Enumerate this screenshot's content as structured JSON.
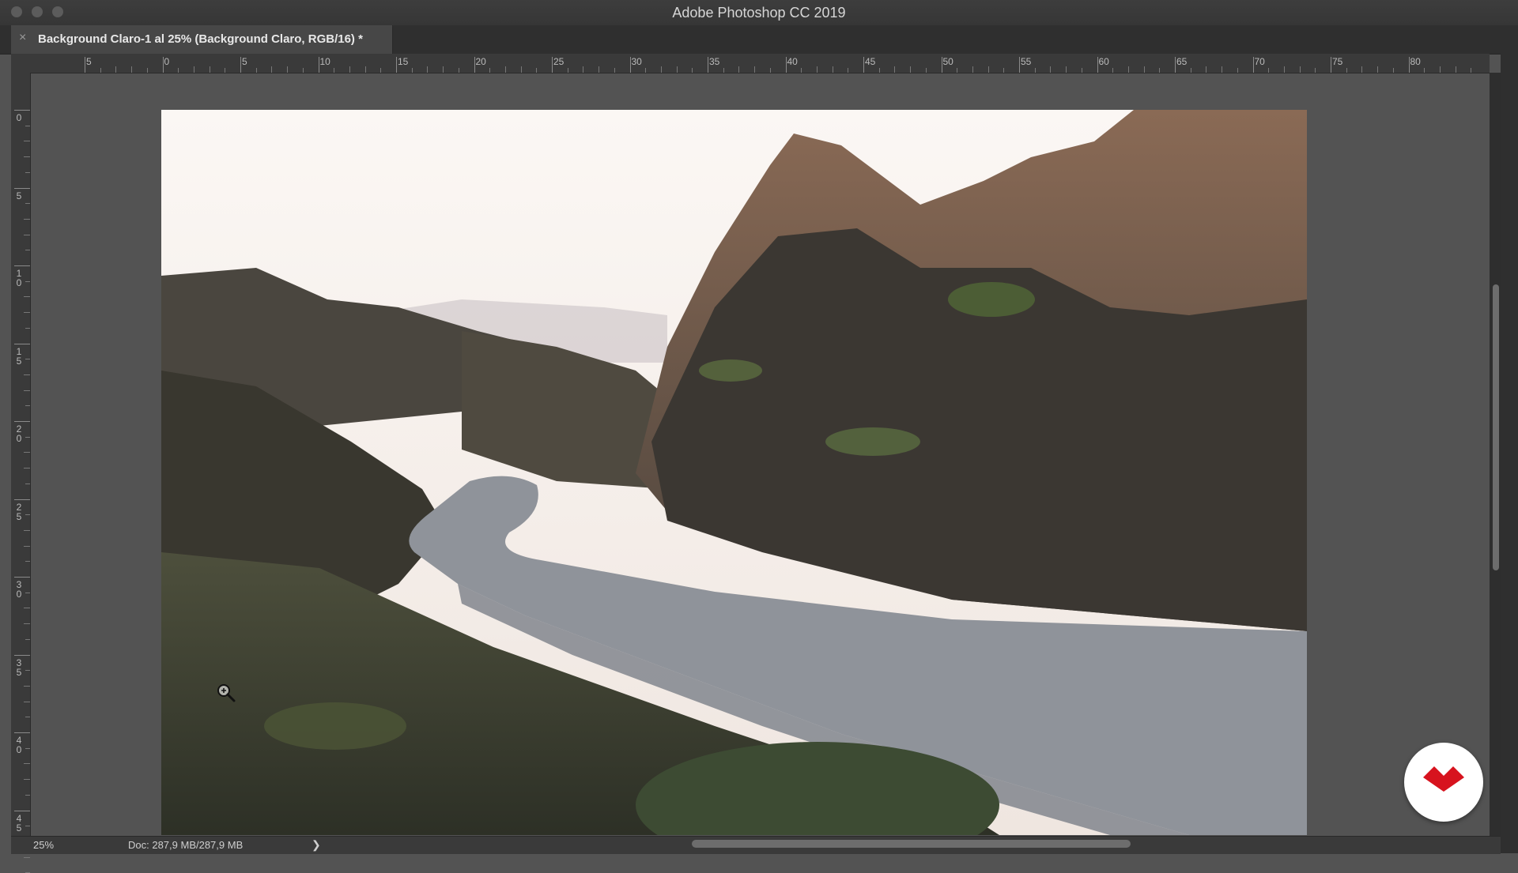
{
  "window": {
    "title": "Adobe Photoshop CC 2019"
  },
  "tab": {
    "close_glyph": "×",
    "title": "Background Claro-1 al 25% (Background Claro, RGB/16) *"
  },
  "ruler_h": {
    "labels": [
      "5",
      "0",
      "5",
      "10",
      "15",
      "20",
      "25",
      "30",
      "35",
      "40",
      "45",
      "50",
      "55",
      "60",
      "65",
      "70",
      "75",
      "80"
    ]
  },
  "ruler_v": {
    "labels": [
      "0",
      "5",
      "1\n0",
      "1\n5",
      "2\n0",
      "2\n5",
      "3\n0",
      "3\n5",
      "4\n0",
      "4\n5"
    ]
  },
  "status": {
    "zoom": "25%",
    "doc": "Doc: 287,9 MB/287,9 MB",
    "arrow": "❯"
  },
  "icons": {
    "cursor": "zoom-in-icon",
    "logo": "brand-logo-icon"
  },
  "colors": {
    "brand": "#d7131e"
  }
}
